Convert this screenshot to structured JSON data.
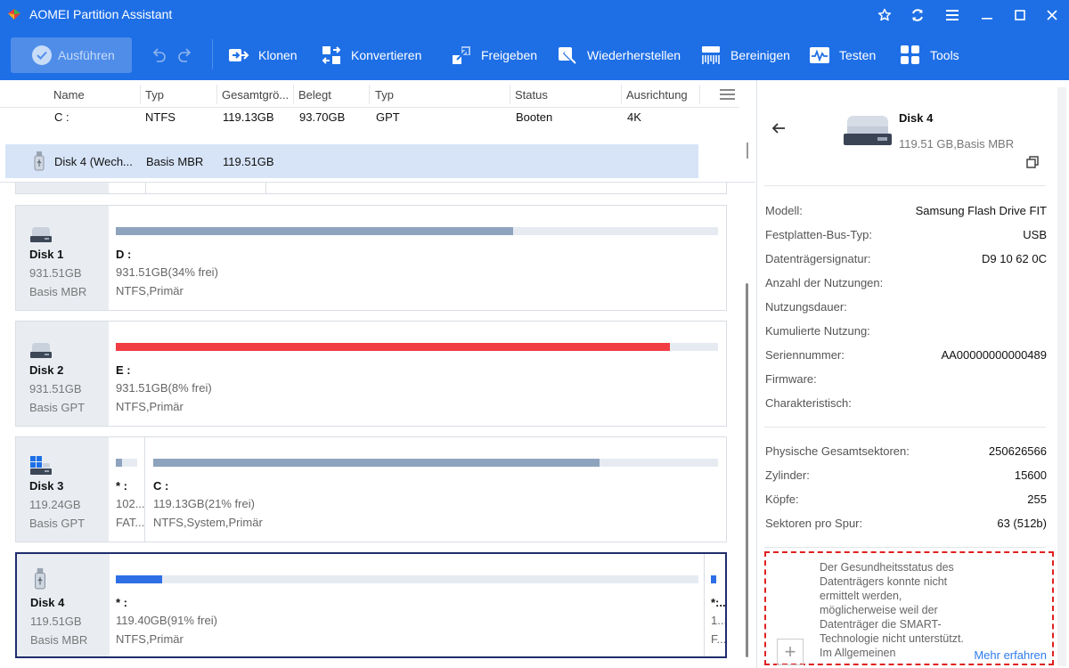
{
  "app": {
    "title": "AOMEI Partition Assistant"
  },
  "colors": {
    "brand": "#1e6fe6",
    "bar_used": "#8ea3bd",
    "bar_critical": "#f23c44",
    "bar_selected": "#2f6fe6",
    "highlight_box": "#e02020"
  },
  "toolbar": {
    "apply_label": "Ausführen",
    "items": [
      {
        "label": "Klonen",
        "icon": "clone-icon"
      },
      {
        "label": "Konvertieren",
        "icon": "convert-icon"
      },
      {
        "label": "Freigeben",
        "icon": "free-space-icon"
      },
      {
        "label": "Wiederherstellen",
        "icon": "recover-icon"
      },
      {
        "label": "Bereinigen",
        "icon": "wipe-icon"
      },
      {
        "label": "Testen",
        "icon": "test-icon"
      },
      {
        "label": "Tools",
        "icon": "tools-icon"
      }
    ]
  },
  "table": {
    "headers": [
      "Name",
      "Typ",
      "Gesamtgrö...",
      "Belegt",
      "Typ",
      "Status",
      "Ausrichtung"
    ],
    "rows": [
      {
        "name": "C :",
        "type": "NTFS",
        "total": "119.13GB",
        "used": "93.70GB",
        "ptype": "GPT",
        "status": "Booten",
        "align": "4K"
      },
      {
        "name": "Disk 4 (Wech...",
        "type": "Basis MBR",
        "total": "119.51GB",
        "used": "",
        "ptype": "",
        "status": "",
        "align": ""
      }
    ]
  },
  "disks": [
    {
      "name": "Disk 1",
      "size": "931.51GB",
      "type": "Basis MBR",
      "partitions": [
        {
          "label": "D :",
          "info": "931.51GB(34% frei)",
          "fs": "NTFS,Primär",
          "used_fraction": 0.66
        }
      ]
    },
    {
      "name": "Disk 2",
      "size": "931.51GB",
      "type": "Basis GPT",
      "partitions": [
        {
          "label": "E :",
          "info": "931.51GB(8% frei)",
          "fs": "NTFS,Primär",
          "used_fraction": 0.92
        }
      ]
    },
    {
      "name": "Disk 3",
      "size": "119.24GB",
      "type": "Basis GPT",
      "partitions": [
        {
          "label": "* :",
          "info": "102....",
          "fs": "FAT...",
          "used_fraction": 0.3
        },
        {
          "label": "C :",
          "info": "119.13GB(21% frei)",
          "fs": "NTFS,System,Primär",
          "used_fraction": 0.79
        }
      ]
    },
    {
      "name": "Disk 4",
      "size": "119.51GB",
      "type": "Basis MBR",
      "partitions": [
        {
          "label": "* :",
          "info": "119.40GB(91% frei)",
          "fs": "NTFS,Primär",
          "used_fraction": 0.08
        },
        {
          "label": "*:..",
          "info": "1...",
          "fs": "F...",
          "used_fraction": 1.0
        }
      ]
    }
  ],
  "panel": {
    "disk_name": "Disk 4",
    "disk_sub": "119.51 GB,Basis MBR",
    "props1": [
      {
        "k": "Modell:",
        "v": "Samsung Flash Drive FIT"
      },
      {
        "k": "Festplatten-Bus-Typ:",
        "v": "USB"
      },
      {
        "k": "Datenträgersignatur:",
        "v": "D9 10 62 0C"
      },
      {
        "k": "Anzahl der Nutzungen:",
        "v": ""
      },
      {
        "k": "Nutzungsdauer:",
        "v": ""
      },
      {
        "k": "Kumulierte Nutzung:",
        "v": ""
      },
      {
        "k": "Seriennummer:",
        "v": "AA00000000000489"
      },
      {
        "k": "Firmware:",
        "v": ""
      },
      {
        "k": "Charakteristisch:",
        "v": ""
      }
    ],
    "props2": [
      {
        "k": "Physische Gesamtsektoren:",
        "v": "250626566"
      },
      {
        "k": "Zylinder:",
        "v": "15600"
      },
      {
        "k": "Köpfe:",
        "v": "255"
      },
      {
        "k": "Sektoren pro Spur:",
        "v": "63 (512b)"
      }
    ],
    "health_text": "Der Gesundheitsstatus des Datenträgers konnte nicht ermittelt werden, möglicherweise weil der Datenträger die SMART-Technologie nicht unterstützt. Im Allgemeinen",
    "health_link": "Mehr erfahren"
  }
}
